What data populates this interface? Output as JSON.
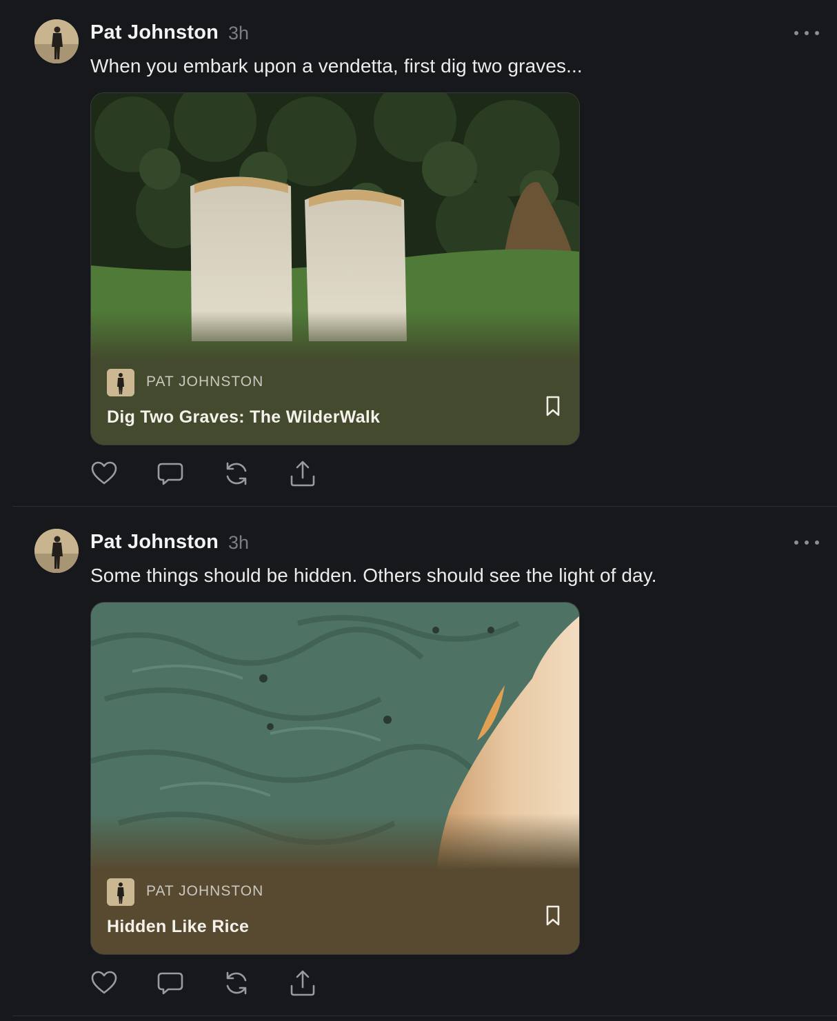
{
  "posts": [
    {
      "author": "Pat Johnston",
      "time": "3h",
      "text": "When you embark upon a vendetta, first dig two graves...",
      "card": {
        "author": "PAT JOHNSTON",
        "title": "Dig Two Graves: The WilderWalk",
        "tint": "#434a2d"
      }
    },
    {
      "author": "Pat Johnston",
      "time": "3h",
      "text": "Some things should be hidden. Others should see the light of day.",
      "card": {
        "author": "PAT JOHNSTON",
        "title": "Hidden Like Rice",
        "tint": "#574a30"
      }
    }
  ],
  "colors": {
    "background": "#17181c",
    "divider": "#2e2f33",
    "muted_text": "#7d7e83"
  },
  "icons": {
    "more": "more-horizontal-icon",
    "like": "heart-icon",
    "comment": "comment-icon",
    "restack": "restack-icon",
    "share": "share-icon",
    "bookmark": "bookmark-icon"
  }
}
